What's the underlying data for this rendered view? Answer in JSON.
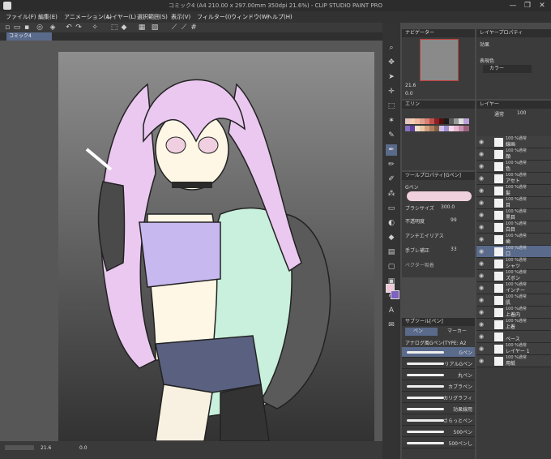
{
  "window": {
    "title": "コミック4 (A4 210.00 x 297.00mm 350dpi 21.6%) - CLIP STUDIO PAINT PRO",
    "minimize": "—",
    "maximize": "❐",
    "close": "✕"
  },
  "menu": [
    "ファイル(F)",
    "編集(E)",
    "アニメーション(A)",
    "レイヤー(L)",
    "選択範囲(S)",
    "表示(V)",
    "フィルター(I)",
    "ウィンドウ(W)",
    "ヘルプ(H)"
  ],
  "document_tab": "コミック4",
  "status": {
    "zoom": "21.6",
    "angle": "0.0"
  },
  "navigator": {
    "title": "ナビゲーター",
    "zoom": "21.6",
    "angle": "0.0"
  },
  "layer_property": {
    "title": "レイヤープロパティ",
    "effect_label": "効果",
    "expression_label": "表現色",
    "expression_value": "カラー"
  },
  "color_set": {
    "title": "エリン",
    "colors": [
      "#e8c4c4",
      "#f0d0b0",
      "#f2b8a0",
      "#e0a090",
      "#d88070",
      "#c05050",
      "#8a2020",
      "#501010",
      "#1a1a1a",
      "#5a5a5a",
      "#9a9a9a",
      "#e0e0e0",
      "#b8a0d8",
      "#8870c0",
      "#6040a0",
      "#f0e0c8",
      "#e8c8a8",
      "#d0a080",
      "#b08060",
      "#806040",
      "#d0c0f0",
      "#a090d0",
      "#f8d8e8",
      "#e8b8d0",
      "#c890b0",
      "#a06080"
    ]
  },
  "tool_property": {
    "title": "ツールプロパティ[Gペン]",
    "current_tool": "Gペン",
    "brush_size_label": "ブラシサイズ",
    "brush_size_value": "300.0",
    "opacity_label": "不透明度",
    "opacity_value": "99",
    "antialias_label": "アンチエイリアス",
    "stabilization_label": "手ブレ補正",
    "stabilization_value": "33",
    "vector_label": "ベクター吸着"
  },
  "sub_tool": {
    "title": "サブツール[ペン]",
    "tab_pen": "ペン",
    "tab_marker": "マーカー",
    "group": "アナログ風Gペン(TYPE: A2",
    "brushes": [
      "Gペン",
      "リアルGペン",
      "丸ペン",
      "カブラペン",
      "カリグラフィ",
      "効果線用",
      "さらっとペン",
      "500ペン",
      "500ペンし"
    ]
  },
  "layers": {
    "title": "レイヤー",
    "blend": "通常",
    "opacity": "100",
    "items": [
      {
        "pct": "100 %通常",
        "name": "線画"
      },
      {
        "pct": "100 %通常",
        "name": "顔"
      },
      {
        "pct": "100 %通常",
        "name": "色"
      },
      {
        "pct": "100 %通常",
        "name": "アセト"
      },
      {
        "pct": "100 %通常",
        "name": "髪"
      },
      {
        "pct": "100 %通常",
        "name": "目"
      },
      {
        "pct": "100 %通常",
        "name": "黒目"
      },
      {
        "pct": "100 %通常",
        "name": "白目"
      },
      {
        "pct": "100 %通常",
        "name": "歯"
      },
      {
        "pct": "100 %通常",
        "name": "口"
      },
      {
        "pct": "100 %通常",
        "name": "シャツ"
      },
      {
        "pct": "100 %通常",
        "name": "ズボン"
      },
      {
        "pct": "100 %通常",
        "name": "インナー"
      },
      {
        "pct": "100 %通常",
        "name": "肌"
      },
      {
        "pct": "100 %通常",
        "name": "上着内"
      },
      {
        "pct": "100 %通常",
        "name": "上着"
      },
      {
        "pct": "",
        "name": "ベース"
      },
      {
        "pct": "100 %通常",
        "name": "レイヤー 1"
      },
      {
        "pct": "100 %通常",
        "name": "用紙"
      }
    ]
  },
  "accent": {
    "panel": "#3b3b3b",
    "selected": "#5a6a8a",
    "title": "#2c2c2c"
  }
}
